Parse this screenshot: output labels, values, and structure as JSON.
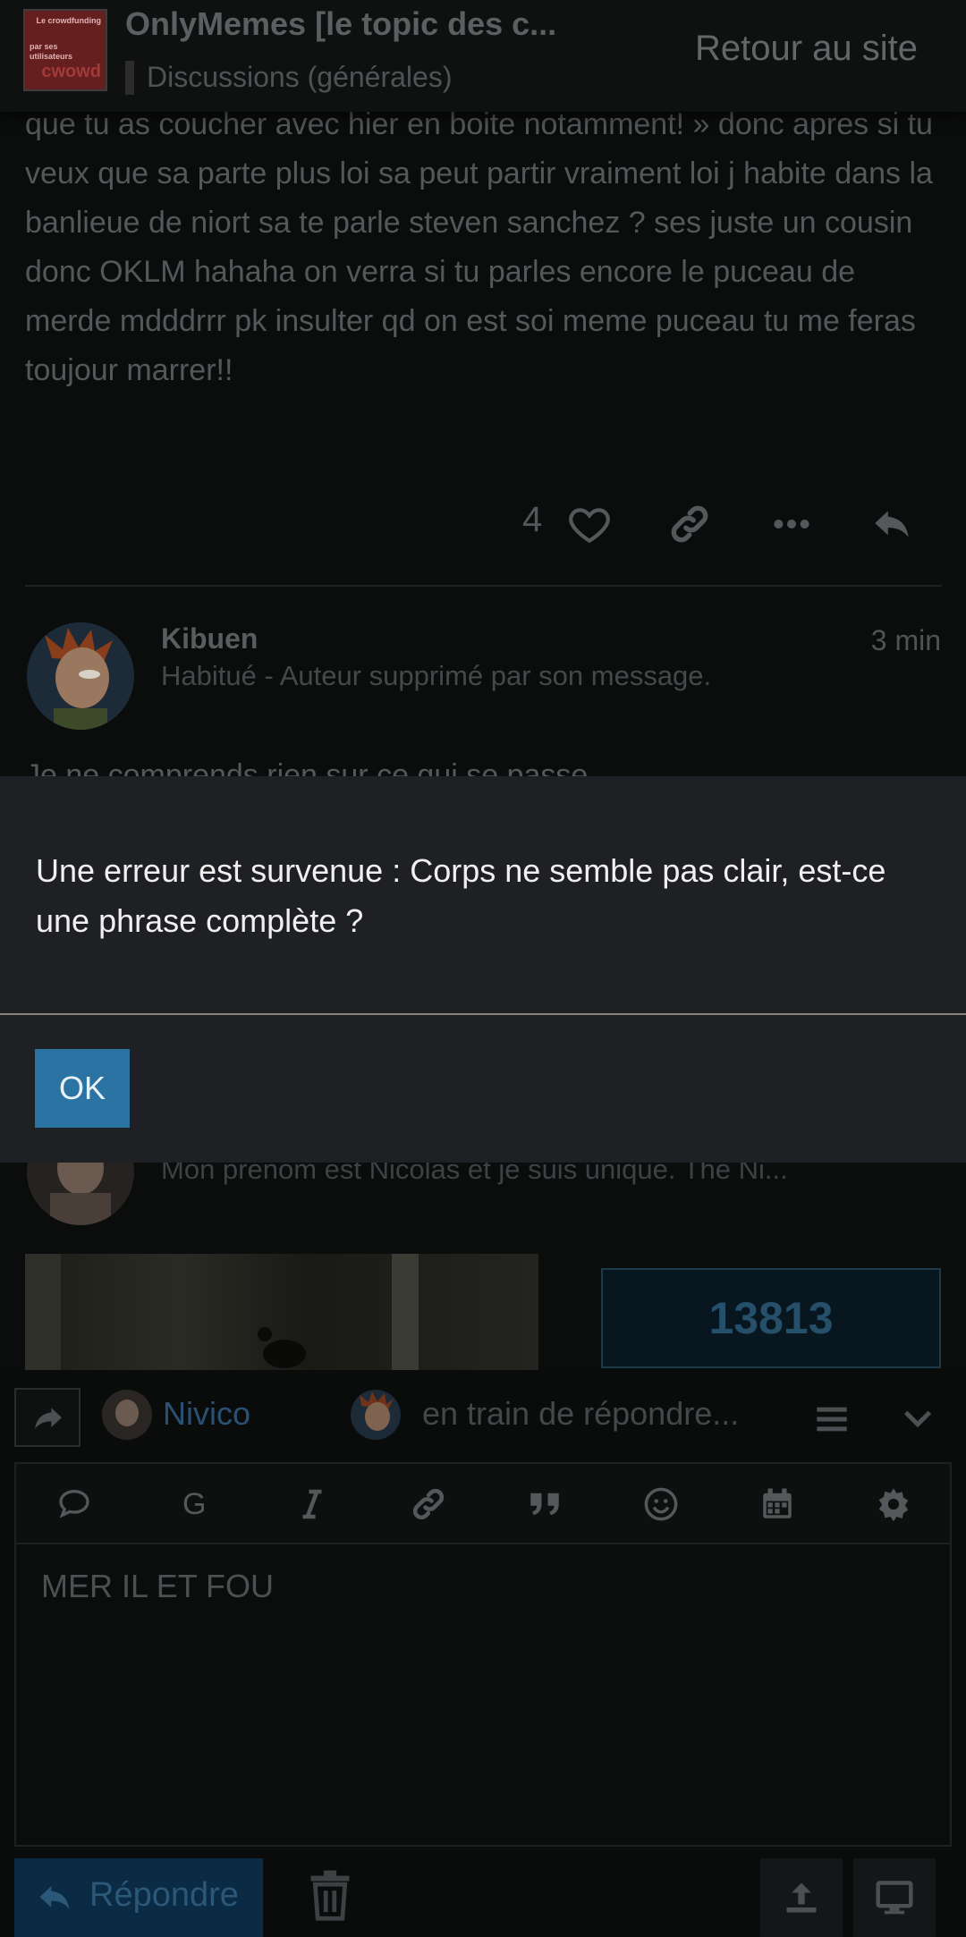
{
  "header": {
    "logo_text_top": "Le crowdfunding",
    "logo_text_mid": "par ses utilisateurs",
    "logo_text_brand": "cwowd",
    "title": "OnlyMemes [le topic des c...",
    "category": "Discussions (générales)",
    "back_link": "Retour au site"
  },
  "post": {
    "body": "que tu as coucher avec hier en boite notamment! » donc apres si tu veux que sa parte plus loi sa peut partir vraiment loi j habite dans la banlieue de niort sa te parle steven sanchez ? ses juste un cousin donc OKLM hahaha on verra si tu parles encore le puceau de merde mdddrrr pk insulter qd on est soi meme puceau tu me feras toujour marrer!!",
    "like_count": "4",
    "icons": [
      "heart-icon",
      "link-icon",
      "more-icon",
      "reply-icon"
    ]
  },
  "reply_post": {
    "author": "Kibuen",
    "author_title": "Habitué - Auteur supprimé par son message.",
    "time": "3 min",
    "body_preview": "Je ne comprends rien sur ce qui se passe"
  },
  "second_post": {
    "user_title": "Mon prenom est Nicolas et je suis unique. The Ni...",
    "counter_value": "13813"
  },
  "composer": {
    "reply_to_user": "Nivico",
    "typing_indicator": "en train de répondre...",
    "editor_text": "MER IL ET FOU",
    "toolbar_bold_label": "G",
    "submit_label": "Répondre"
  },
  "modal": {
    "message": "Une erreur est survenue : Corps ne semble pas clair, est-ce une phrase complète ?",
    "ok_label": "OK"
  },
  "colors": {
    "modal_bg": "#1f2023",
    "ok_button": "#2a73a3",
    "page_bg": "#0b0c0c",
    "link_blue": "#2a5173"
  }
}
